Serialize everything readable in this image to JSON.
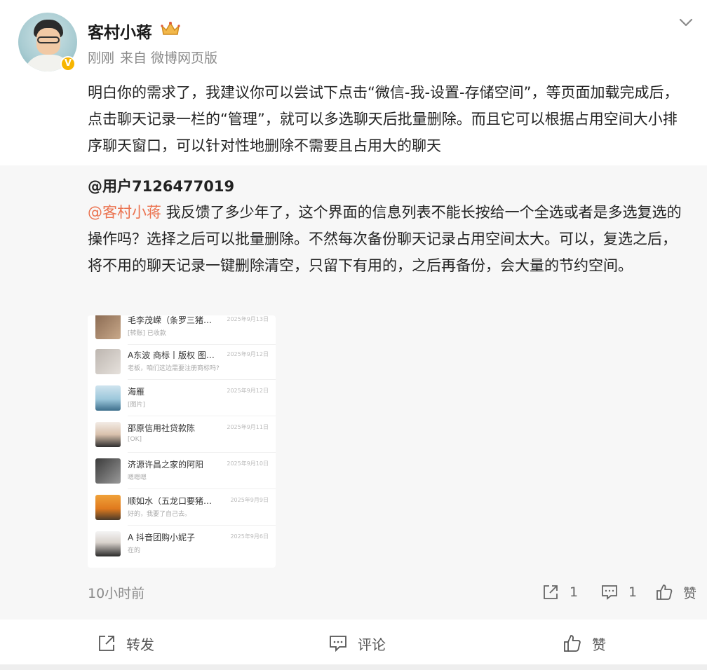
{
  "post": {
    "username": "客村小蒋",
    "time": "刚刚",
    "source": "来自 微博网页版",
    "text": "明白你的需求了，我建议你可以尝试下点击“微信-我-设置-存储空间”，等页面加载完成后，点击聊天记录一栏的“管理”，就可以多选聊天后批量删除。而且它可以根据占用空间大小排序聊天窗口，可以针对性地删除不需要且占用大的聊天",
    "verified_badge": "V"
  },
  "repost": {
    "author": "@用户7126477019",
    "mention": "@客村小蒋",
    "text": " 我反馈了多少年了，这个界面的信息列表不能长按给一个全选或者是多选复选的操作吗？选择之后可以批量删除。不然每次备份聊天记录占用空间太大。可以，复选之后，将不用的聊天记录一键删除清空，只留下有用的，之后再备份，会大量的节约空间。",
    "time": "10小时前",
    "repost_count": "1",
    "comment_count": "1",
    "like_label": "赞"
  },
  "chat_list": [
    {
      "name": "毛李茂嵘（条罗三猪…",
      "preview": "[转账] 已收款",
      "date": "2025年9月13日"
    },
    {
      "name": "A东波 商标丨版权 图…",
      "preview": "老板，咱们这边需要注册商标吗?",
      "date": "2025年9月12日"
    },
    {
      "name": "海雁",
      "preview": "[图片]",
      "date": "2025年9月12日"
    },
    {
      "name": "邵原信用社贷款陈",
      "preview": "[OK]",
      "date": "2025年9月11日"
    },
    {
      "name": "济源许昌之家的阿阳",
      "preview": "嗯嗯嗯",
      "date": "2025年9月10日"
    },
    {
      "name": "顺如水（五龙口要猪…",
      "preview": "好的，我要了自己去。",
      "date": "2025年9月9日"
    },
    {
      "name": "A 抖音团购小妮子",
      "preview": "在的",
      "date": "2025年9月6日"
    }
  ],
  "actions": {
    "repost": "转发",
    "comment": "评论",
    "like": "赞"
  },
  "colors": {
    "mention": "#eb7350",
    "badge": "#f7b500",
    "repost_bg": "#f7f7f7"
  },
  "icons": [
    "crown-icon",
    "chevron-down-icon",
    "repost-icon",
    "comment-icon",
    "like-icon"
  ]
}
